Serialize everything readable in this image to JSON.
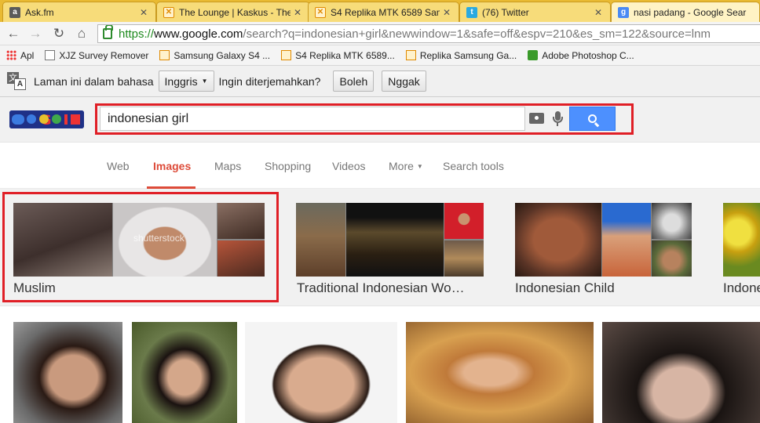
{
  "tabs": [
    {
      "title": "Ask.fm",
      "favicon": "askfm-icon"
    },
    {
      "title": "The Lounge | Kaskus - The",
      "favicon": "kaskus-icon"
    },
    {
      "title": "S4 Replika MTK 6589 Sams",
      "favicon": "kaskus-icon"
    },
    {
      "title": "(76) Twitter",
      "favicon": "twitter-icon"
    },
    {
      "title": "nasi padang - Google Sear",
      "favicon": "google-icon"
    }
  ],
  "omnibox": {
    "secure": "https://",
    "host": "www.google.com",
    "rest": "/search?q=indonesian+girl&newwindow=1&safe=off&espv=210&es_sm=122&source=lnm"
  },
  "bookmarks": [
    {
      "label": "Apl",
      "icon": "apps-icon"
    },
    {
      "label": "XJZ Survey Remover",
      "icon": "page-icon"
    },
    {
      "label": "Samsung Galaxy S4 ...",
      "icon": "kaskus-icon"
    },
    {
      "label": "S4 Replika MTK 6589...",
      "icon": "kaskus-icon"
    },
    {
      "label": "Replika Samsung Ga...",
      "icon": "kaskus-icon"
    },
    {
      "label": "Adobe Photoshop C...",
      "icon": "download-icon"
    }
  ],
  "translate_bar": {
    "prefix": "Laman ini dalam bahasa",
    "language": "Inggris",
    "question": "Ingin diterjemahkan?",
    "yes": "Boleh",
    "no": "Nggak"
  },
  "search": {
    "query": "indonesian girl"
  },
  "nav": {
    "web": "Web",
    "images": "Images",
    "maps": "Maps",
    "shopping": "Shopping",
    "videos": "Videos",
    "more": "More",
    "search_tools": "Search tools"
  },
  "related": [
    {
      "label": "Muslim"
    },
    {
      "label": "Traditional Indonesian Wo…"
    },
    {
      "label": "Indonesian Child"
    },
    {
      "label": "Indone"
    }
  ],
  "watermark": "shutterstock",
  "colors": {
    "tab_strip": "#e9ba32",
    "highlight_red": "#e01f26",
    "search_blue": "#4d90fe",
    "active_tab_red": "#dd4b39"
  }
}
